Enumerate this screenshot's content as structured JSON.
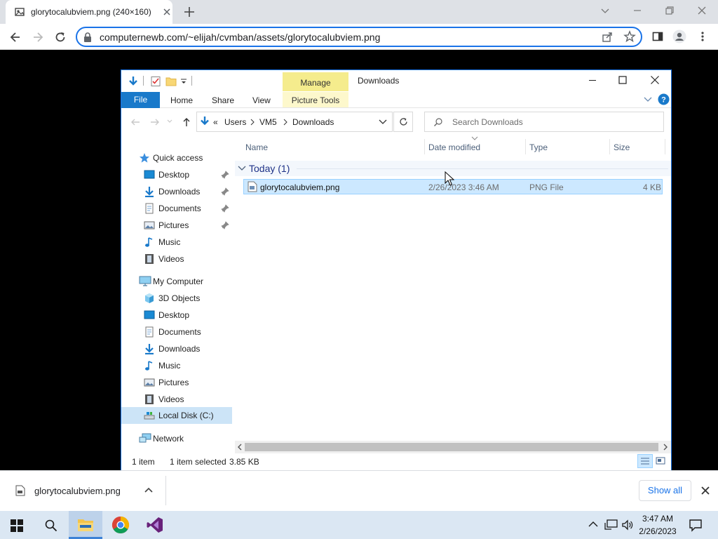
{
  "browser": {
    "tab_title": "glorytocalubviem.png (240×160)",
    "url": "computernewb.com/~elijah/cvmban/assets/glorytocalubviem.png"
  },
  "explorer": {
    "title": "Downloads",
    "manage_tab": "Manage",
    "picture_tools": "Picture Tools",
    "ribbon_tabs": [
      "File",
      "Home",
      "Share",
      "View"
    ],
    "breadcrumb": {
      "overflow": "«",
      "parts": [
        "Users",
        "VM5",
        "Downloads"
      ]
    },
    "search_placeholder": "Search Downloads",
    "nav": {
      "quick_access": "Quick access",
      "quick_items": [
        "Desktop",
        "Downloads",
        "Documents",
        "Pictures",
        "Music",
        "Videos"
      ],
      "my_computer": "My Computer",
      "computer_items": [
        "3D Objects",
        "Desktop",
        "Documents",
        "Downloads",
        "Music",
        "Pictures",
        "Videos",
        "Local Disk (C:)"
      ],
      "network": "Network"
    },
    "columns": [
      "Name",
      "Date modified",
      "Type",
      "Size"
    ],
    "group_label": "Today (1)",
    "files": [
      {
        "name": "glorytocalubviem.png",
        "date": "2/26/2023 3:46 AM",
        "type": "PNG File",
        "size": "4 KB"
      }
    ],
    "status": {
      "count": "1 item",
      "selected": "1 item selected",
      "size": "3.85 KB"
    }
  },
  "download_shelf": {
    "filename": "glorytocalubviem.png",
    "show_all": "Show all"
  },
  "taskbar": {
    "time": "3:47 AM",
    "date": "2/26/2023"
  }
}
